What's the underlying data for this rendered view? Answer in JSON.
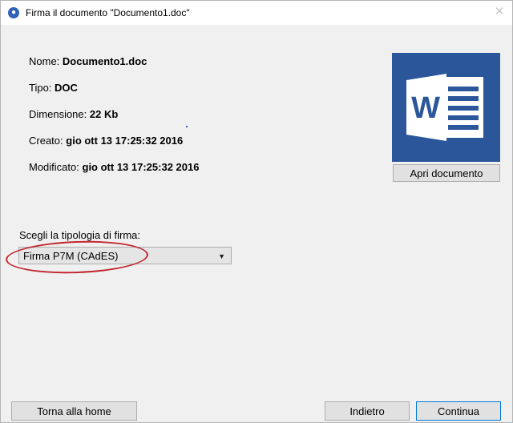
{
  "window": {
    "title": "Firma il documento \"Documento1.doc\"",
    "app_icon": "user-circle-icon",
    "close_icon": "close-icon"
  },
  "document": {
    "name_label": "Nome:",
    "name_value": "Documento1.doc",
    "type_label": "Tipo:",
    "type_value": "DOC",
    "size_label": "Dimensione:",
    "size_value": "22 Kb",
    "created_label": "Creato:",
    "created_value": "gio ott 13 17:25:32 2016",
    "modified_label": "Modificato:",
    "modified_value": "gio ott 13 17:25:32 2016"
  },
  "preview": {
    "icon": "word-document-icon",
    "open_button": "Apri documento"
  },
  "signature": {
    "label": "Scegli la tipologia di firma:",
    "selected": "Firma P7M (CAdES)"
  },
  "footer": {
    "home_button": "Torna alla home",
    "back_button": "Indietro",
    "continue_button": "Continua"
  },
  "colors": {
    "word_blue": "#2b579a",
    "highlight_red": "#c2262f",
    "focus_blue": "#0078d7"
  }
}
